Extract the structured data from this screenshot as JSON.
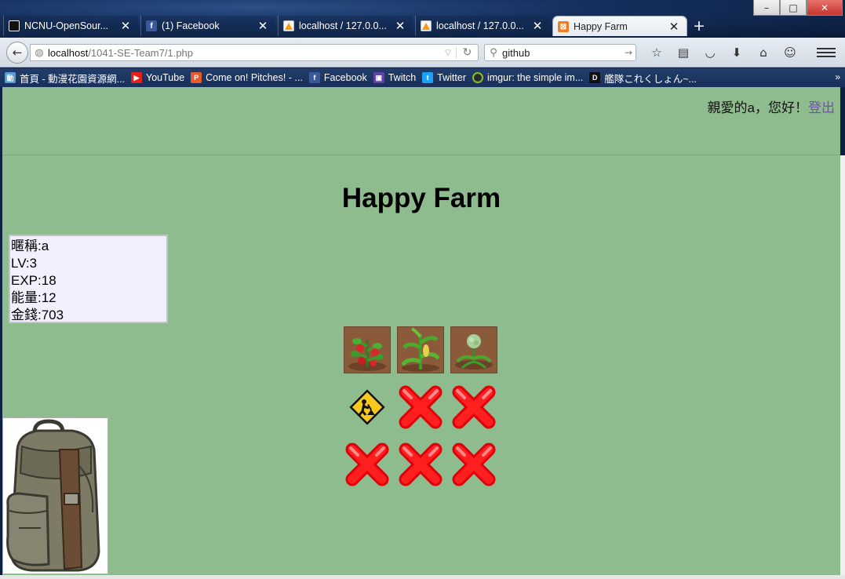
{
  "window": {
    "controls": [
      "–",
      "□",
      "✕"
    ]
  },
  "tabs": [
    {
      "title": "NCNU-OpenSour...",
      "icon": "github-icon"
    },
    {
      "title": "(1) Facebook",
      "icon": "facebook-icon"
    },
    {
      "title": "localhost / 127.0.0...",
      "icon": "phpmyadmin-icon"
    },
    {
      "title": "localhost / 127.0.0...",
      "icon": "phpmyadmin-icon"
    },
    {
      "title": "Happy Farm",
      "icon": "xampp-icon",
      "active": true
    }
  ],
  "toolbar": {
    "url_host": "localhost",
    "url_path": "/1041-SE-Team7/1.php",
    "search_value": "github",
    "icons": [
      "bookmark-star-icon",
      "reading-list-icon",
      "pocket-icon",
      "download-icon",
      "home-icon",
      "chat-icon"
    ]
  },
  "bookmarks": [
    {
      "label": "首頁 - 動漫花園資源網...",
      "icon": "anime-icon",
      "color": "#5a9bd6"
    },
    {
      "label": "YouTube",
      "icon": "youtube-icon",
      "color": "#e62117"
    },
    {
      "label": "Come on! Pitches! - ...",
      "icon": "pitches-icon",
      "color": "#e8592b"
    },
    {
      "label": "Facebook",
      "icon": "facebook-icon",
      "color": "#3b5998"
    },
    {
      "label": "Twitch",
      "icon": "twitch-icon",
      "color": "#6441a5"
    },
    {
      "label": "Twitter",
      "icon": "twitter-icon",
      "color": "#1da1f2"
    },
    {
      "label": "imgur: the simple im...",
      "icon": "imgur-icon",
      "color": "#2b2b2b"
    },
    {
      "label": "艦隊これくしょん~...",
      "icon": "kancolle-icon",
      "color": "#111111"
    }
  ],
  "page": {
    "background": "#8fbc8f",
    "greeting": "親愛的a，您好！",
    "logout": "登出",
    "title": "Happy Farm",
    "stats": {
      "nickname": "暱稱:a",
      "level": "LV:3",
      "exp": "EXP:18",
      "energy": "能量:12",
      "money": "金錢:703"
    },
    "farm_plots": [
      {
        "state": "tomato",
        "icon": "tomato-plant-icon"
      },
      {
        "state": "corn",
        "icon": "corn-plant-icon"
      },
      {
        "state": "cabbage",
        "icon": "cabbage-plant-icon"
      },
      {
        "state": "under-construction",
        "icon": "construction-sign-icon"
      },
      {
        "state": "locked",
        "icon": "locked-x-icon"
      },
      {
        "state": "locked",
        "icon": "locked-x-icon"
      },
      {
        "state": "locked",
        "icon": "locked-x-icon"
      },
      {
        "state": "locked",
        "icon": "locked-x-icon"
      },
      {
        "state": "locked",
        "icon": "locked-x-icon"
      }
    ],
    "backpack_icon": "backpack-icon"
  }
}
